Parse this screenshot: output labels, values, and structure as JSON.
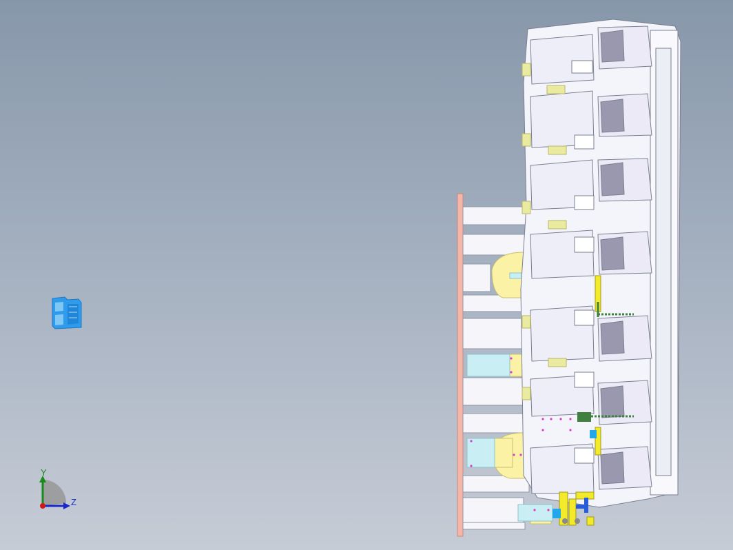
{
  "viewport": {
    "background_top": "#8797aa",
    "background_bottom": "#c6ccd6"
  },
  "triad": {
    "y_label": "Y",
    "z_label": "Z",
    "colors": {
      "y": "#1a8a1a",
      "z": "#1a28c8",
      "x": "#d01818"
    }
  },
  "view_cube": {
    "icon": "view-orientation-icon",
    "color": "#2f9bea"
  },
  "model": {
    "part_color": "#f4f4fb",
    "edge_color": "#7a7f90",
    "base_plate_color": "#f4b6a8",
    "support_color": "#fbf2a6",
    "bracket_color": "#c9eef4",
    "clamp_color": "#f2ea2a",
    "spring_color": "#3f7f3f",
    "pin_color": "#e23ad0"
  }
}
